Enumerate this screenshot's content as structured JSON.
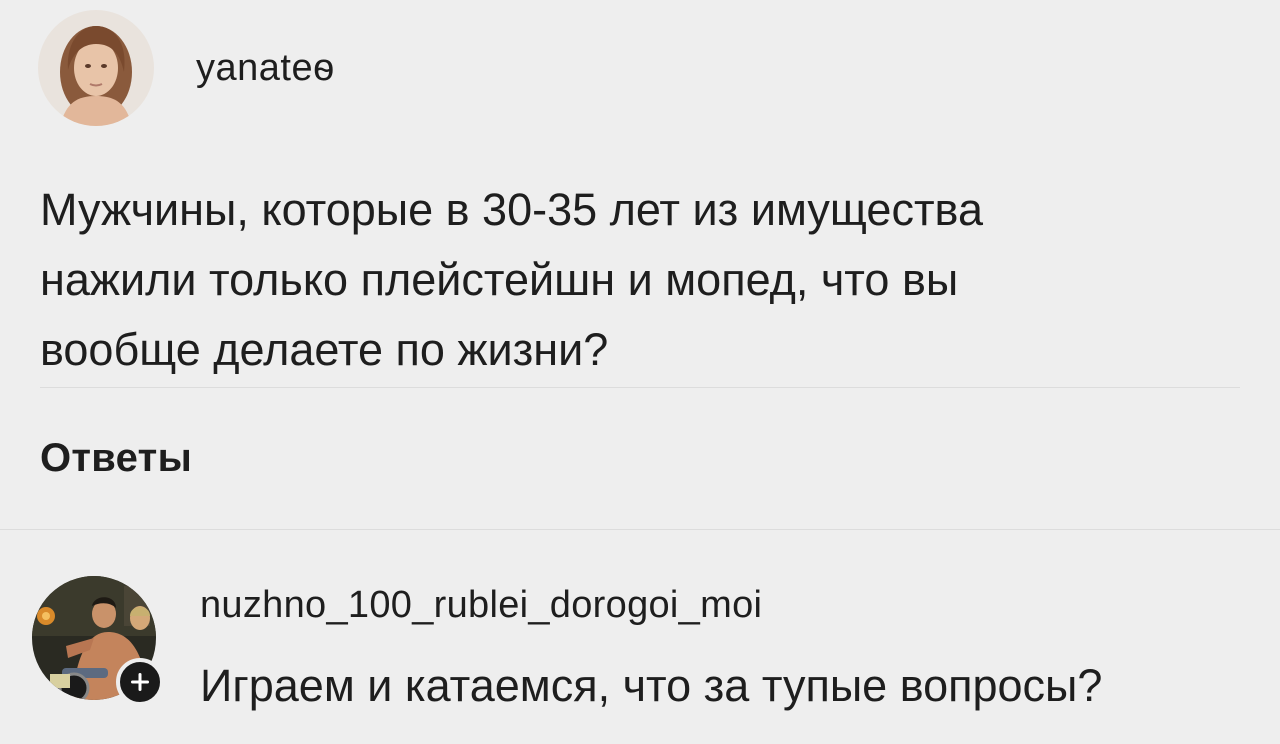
{
  "post": {
    "username": "yanateѳ",
    "text": "Мужчины, которые в 30-35 лет из имущества\nнажили только плейстейшн и мопед, что вы\nвообще делаете по жизни?"
  },
  "replies_section": {
    "title": "Ответы"
  },
  "replies": [
    {
      "username": "nuzhno_100_rublei_dorogoi_moi",
      "text": "Играем и катаемся, что за тупые вопросы?",
      "badge_icon": "plus-icon"
    }
  ],
  "colors": {
    "background": "#eeeeee",
    "text": "#1e1e1e",
    "divider": "#dcdcdc",
    "badge": "#1a1a1a"
  }
}
